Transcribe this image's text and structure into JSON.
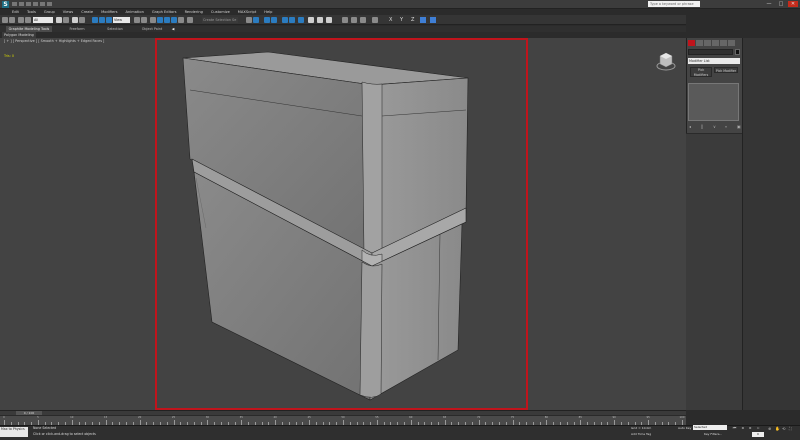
{
  "app": {
    "logo_letter": "S",
    "search_placeholder": "Type a keyword or phrase"
  },
  "window_controls": {
    "minimize": "—",
    "maximize": "□",
    "close": "✕"
  },
  "menu": [
    "Edit",
    "Tools",
    "Group",
    "Views",
    "Create",
    "Modifiers",
    "Animation",
    "Graph Editors",
    "Rendering",
    "Customize",
    "MAXScript",
    "Help"
  ],
  "toolbar": {
    "selection_filter": "All",
    "ref_coord": "View",
    "named_sel": "Create Selection Se",
    "axis": [
      "X",
      "Y",
      "Z"
    ]
  },
  "ribbon": {
    "tabs": [
      "Graphite Modeling Tools",
      "Freeform",
      "Selection",
      "Object Paint"
    ],
    "sub_label": "Polygon Modeling"
  },
  "viewport": {
    "label": "[ + ] [ Perspective ] [ Smooth + Highlights + Edged Faces ]",
    "stats": "Tris:  0"
  },
  "command_panel": {
    "modifier_list": "Modifier List",
    "btn_1": "Pick Modifiers",
    "btn_2": "Pick Modifier",
    "stack_icons": [
      "pin-stack",
      "show-end-result",
      "make-unique",
      "remove-modifier",
      "configure-sets"
    ]
  },
  "timeline": {
    "slider": "0 / 100",
    "ticks": [
      "0",
      "5",
      "10",
      "15",
      "20",
      "25",
      "30",
      "35",
      "40",
      "45",
      "50",
      "55",
      "60",
      "65",
      "70",
      "75",
      "80",
      "85",
      "90",
      "95",
      "100"
    ]
  },
  "status": {
    "listener": "Max to Physics",
    "prompt": "None Selected",
    "help": "Click or click-and-drag to select objects",
    "grid": "Grid = 10.0m",
    "add_time_tag": "Add Time Tag",
    "autokey_label": "Auto Key",
    "autokey_value": "Selected",
    "set_key_label": "Set Key",
    "key_filters": "Key Filters...",
    "frame": "0"
  }
}
